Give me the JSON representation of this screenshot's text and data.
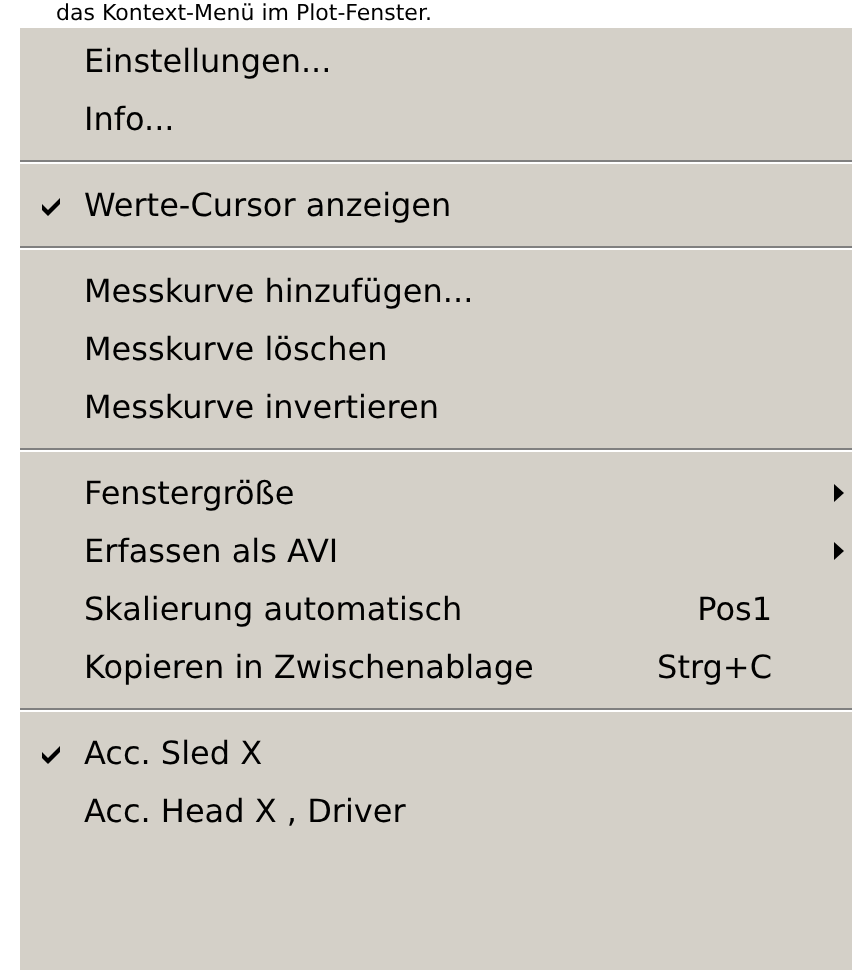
{
  "heading": "das Kontext-Menü im Plot-Fenster.",
  "menu": {
    "items": [
      {
        "kind": "item",
        "label": "Einstellungen...",
        "checked": false
      },
      {
        "kind": "item",
        "label": "Info...",
        "checked": false
      },
      {
        "kind": "separator"
      },
      {
        "kind": "item",
        "label": "Werte-Cursor anzeigen",
        "checked": true
      },
      {
        "kind": "separator"
      },
      {
        "kind": "item",
        "label": "Messkurve hinzufügen...",
        "checked": false
      },
      {
        "kind": "item",
        "label": "Messkurve löschen",
        "checked": false
      },
      {
        "kind": "item",
        "label": "Messkurve invertieren",
        "checked": false
      },
      {
        "kind": "separator"
      },
      {
        "kind": "item",
        "label": "Fenstergröße",
        "checked": false,
        "submenu": true
      },
      {
        "kind": "item",
        "label": "Erfassen als AVI",
        "checked": false,
        "submenu": true
      },
      {
        "kind": "item",
        "label": "Skalierung automatisch",
        "checked": false,
        "shortcut": "Pos1"
      },
      {
        "kind": "item",
        "label": "Kopieren in Zwischenablage",
        "checked": false,
        "shortcut": "Strg+C"
      },
      {
        "kind": "separator"
      },
      {
        "kind": "item",
        "label": "Acc. Sled X",
        "checked": true
      },
      {
        "kind": "item",
        "label": "Acc. Head X , Driver",
        "checked": false
      }
    ]
  }
}
